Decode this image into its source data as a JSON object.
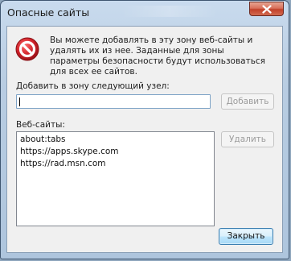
{
  "window": {
    "title": "Опасные сайты"
  },
  "dialog": {
    "info_text": "Вы можете добавлять в эту зону  веб-сайты и удалять их из нее. Заданные для зоны параметры безопасности будут использоваться для всех ее сайтов.",
    "add_label": "Добавить в зону следующий узел:",
    "add_input_value": "",
    "add_button": "Добавить",
    "sites_label": "Веб-сайты:",
    "sites": [
      "about:tabs",
      "https://apps.skype.com",
      "https://rad.msn.com"
    ],
    "remove_button": "Удалить",
    "close_button": "Закрыть"
  },
  "icons": {
    "window_close": "close-icon",
    "restricted": "restricted-zone-stop-icon"
  },
  "colors": {
    "stop_red": "#d0222a",
    "close_button_red": "#c2412a",
    "focus_blue": "#3c7fb1"
  }
}
